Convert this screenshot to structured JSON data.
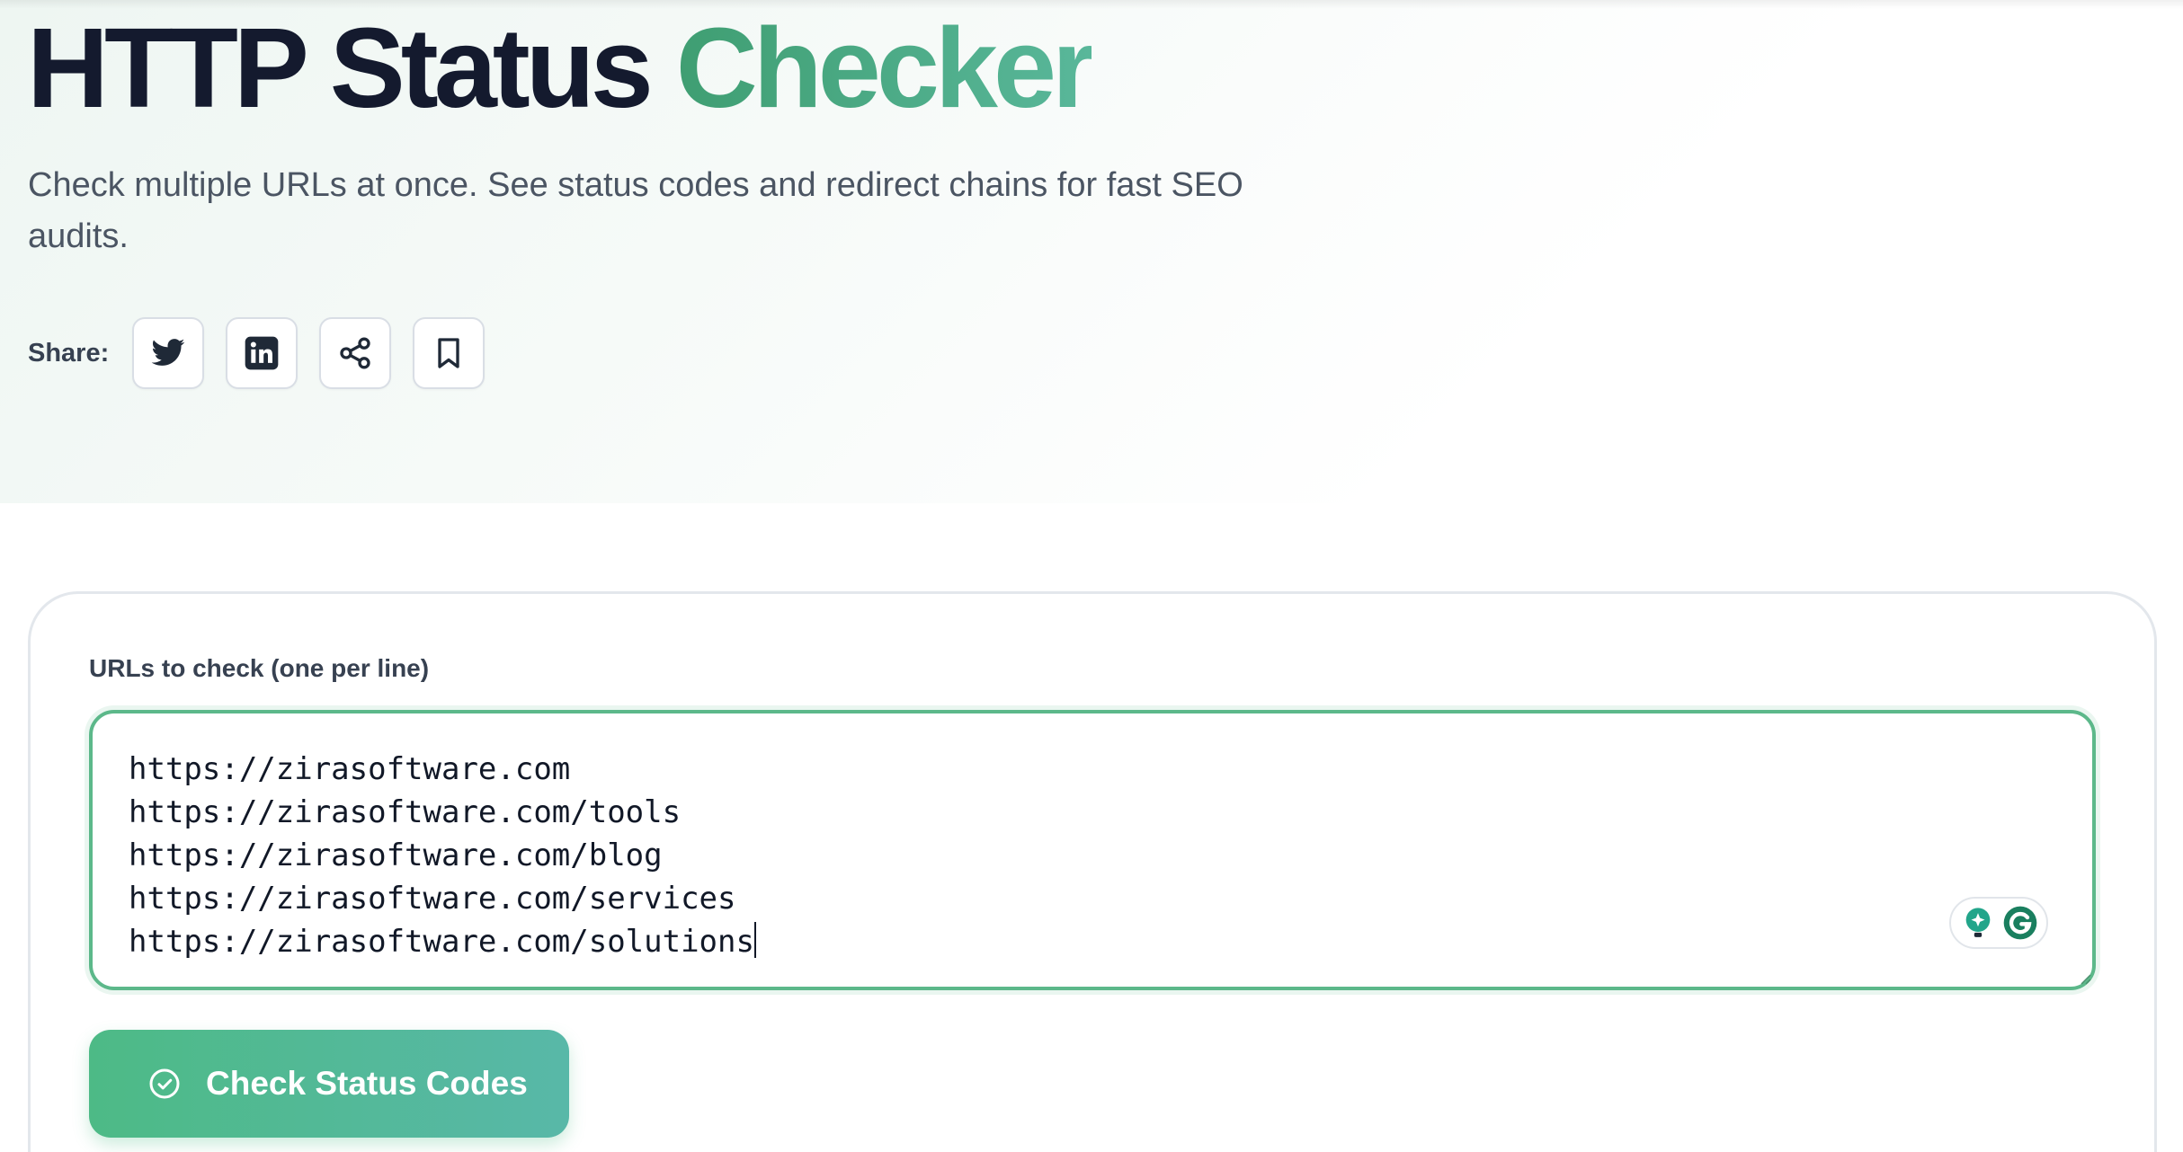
{
  "header": {
    "title_main": "HTTP Status",
    "title_accent": "Checker",
    "subtitle": "Check multiple URLs at once. See status codes and redirect chains for fast SEO audits."
  },
  "share": {
    "label": "Share:",
    "buttons": [
      {
        "icon": "twitter-icon"
      },
      {
        "icon": "linkedin-icon"
      },
      {
        "icon": "share-icon"
      },
      {
        "icon": "bookmark-icon"
      }
    ]
  },
  "form": {
    "urls_label": "URLs to check (one per line)",
    "urls_value": "https://zirasoftware.com\nhttps://zirasoftware.com/tools\nhttps://zirasoftware.com/blog\nhttps://zirasoftware.com/services\nhttps://zirasoftware.com/solutions",
    "submit_label": "Check Status Codes"
  },
  "colors": {
    "accent_green": "#3f9e72",
    "accent_teal": "#58b8a8",
    "title_dark": "#141a2e",
    "textarea_border": "#5cb88a"
  }
}
